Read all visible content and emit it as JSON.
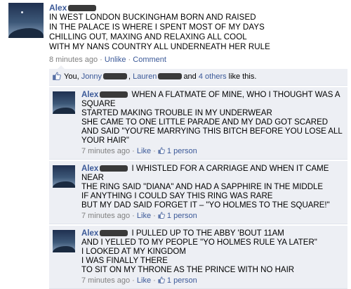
{
  "post": {
    "author": "Alex",
    "text": "IN WEST LONDON BUCKINGHAM BORN AND RAISED\nIN THE PALACE IS WHERE I SPENT MOST OF MY DAYS\nCHILLING OUT, MAXING AND RELAXING ALL COOL\nWITH MY NANS COUNTRY ALL UNDERNEATH HER RULE",
    "time": "8 minutes ago",
    "unlike": "Unlike",
    "comment": "Comment",
    "sep": "·"
  },
  "likes": {
    "prefix": "You, ",
    "name1": "Jonny",
    "sep1": ", ",
    "name2": "Lauren",
    "middle": "and ",
    "others": "4 others",
    "suffix": " like this."
  },
  "comments": [
    {
      "author": "Alex",
      "text": "WHEN A FLATMATE OF MINE, WHO I THOUGHT WAS A SQUARE\nSTARTED MAKING TROUBLE IN MY UNDERWEAR\nSHE CAME TO ONE LITTLE PARADE AND MY DAD GOT SCARED\nAND SAID \"YOU'RE MARRYING THIS BITCH BEFORE YOU LOSE ALL YOUR HAIR\"",
      "time": "7 minutes ago",
      "like": "Like",
      "likes_count": "1 person"
    },
    {
      "author": "Alex",
      "text": "I WHISTLED FOR A CARRIAGE AND WHEN IT CAME NEAR\nTHE RING SAID \"DIANA\" AND HAD A SAPPHIRE IN THE MIDDLE\nIF ANYTHING I COULD SAY THIS RING WAS RARE\nBUT MY DAD SAID FORGET IT – \"YO HOLMES TO THE SQUARE!\"",
      "time": "7 minutes ago",
      "like": "Like",
      "likes_count": "1 person"
    },
    {
      "author": "Alex",
      "text": "I PULLED UP TO THE ABBY 'BOUT 11AM\nAND I YELLED TO MY PEOPLE \"YO HOLMES RULE YA LATER\"\nI LOOKED AT MY KINGDOM\nI WAS FINALLY THERE\nTO SIT ON MY THRONE AS THE PRINCE WITH NO HAIR",
      "time": "7 minutes ago",
      "like": "Like",
      "likes_count": "1 person"
    }
  ],
  "colors": {
    "link": "#3b5998",
    "meta": "#808080",
    "comment_bg": "#edeff4"
  },
  "icons": {
    "like": "thumbs-up-icon",
    "redaction": "redacted-name-scribble"
  }
}
